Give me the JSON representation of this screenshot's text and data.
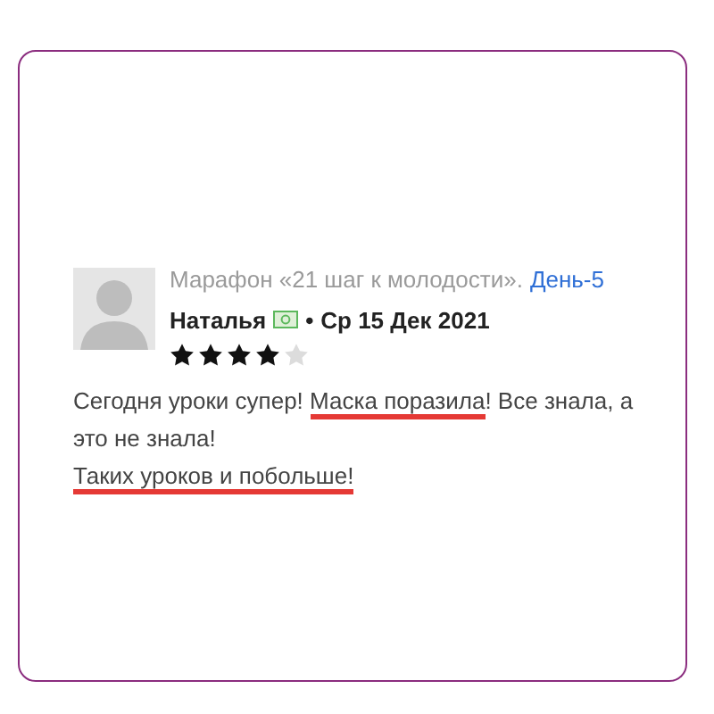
{
  "review": {
    "source": "Марафон «21 шаг к молодости».",
    "source_link": "День-5",
    "author": "Наталья",
    "separator": "•",
    "date": "Ср 15 Дек 2021",
    "stars": 4,
    "paragraphs": [
      [
        {
          "text": "Сегодня уроки супер! ",
          "highlighted": false
        },
        {
          "text": "Маска поразила",
          "highlighted": true
        },
        {
          "text": "! Все знала, а это не знала!",
          "highlighted": false
        }
      ],
      [
        {
          "text": "Таких уроков и побольше!",
          "highlighted": true
        }
      ]
    ]
  }
}
